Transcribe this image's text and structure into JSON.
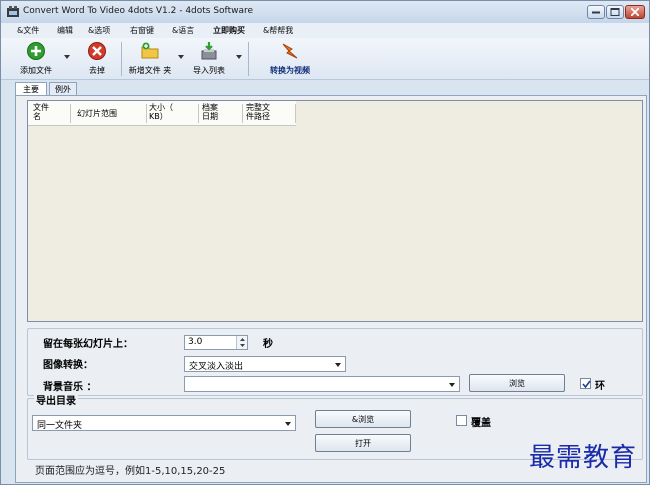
{
  "window": {
    "title": "Convert Word To Video 4dots V1.2 - 4dots Software",
    "controls": {
      "minimize": "minimize",
      "maximize": "maximize",
      "close": "close"
    }
  },
  "menu": [
    "&文件",
    "编辑",
    "&选项",
    "右窗键",
    "&语言",
    "立即购买",
    "&帮帮我"
  ],
  "toolbar": {
    "add_file": "添加文件",
    "remove": "去掉",
    "add_folder": "新增文件 夹",
    "import_list": "导入列表",
    "convert": "转换为视频"
  },
  "tabs": [
    "主要",
    "例外"
  ],
  "list": {
    "columns": [
      "文件\n名",
      "幻灯片范围",
      "大小（\nKB）",
      "档案\n日期",
      "完整文\n件路径"
    ],
    "rows": []
  },
  "settings": {
    "duration_label": "留在每张幻灯片上：",
    "duration_value": "3.0",
    "duration_unit": "秒",
    "transition_label": "图像转换：",
    "transition_value": "交叉淡入淡出",
    "music_label": "背景音乐 ：",
    "music_value": "",
    "browse_label": "浏览",
    "loop_label": "环",
    "loop_checked": true
  },
  "output": {
    "title": "导出目录",
    "folder_value": "同一文件夹",
    "browse_label": "&浏览",
    "open_label": "打开",
    "overwrite_label": "覆盖",
    "overwrite_checked": false
  },
  "note": "页面范围应为逗号，例如1-5,10,15,20-25",
  "watermark": "最需教育",
  "colors": {
    "window_bg": "#d9e4f1",
    "list_bg": "#efede2",
    "watermark": "#1a2aa8"
  }
}
